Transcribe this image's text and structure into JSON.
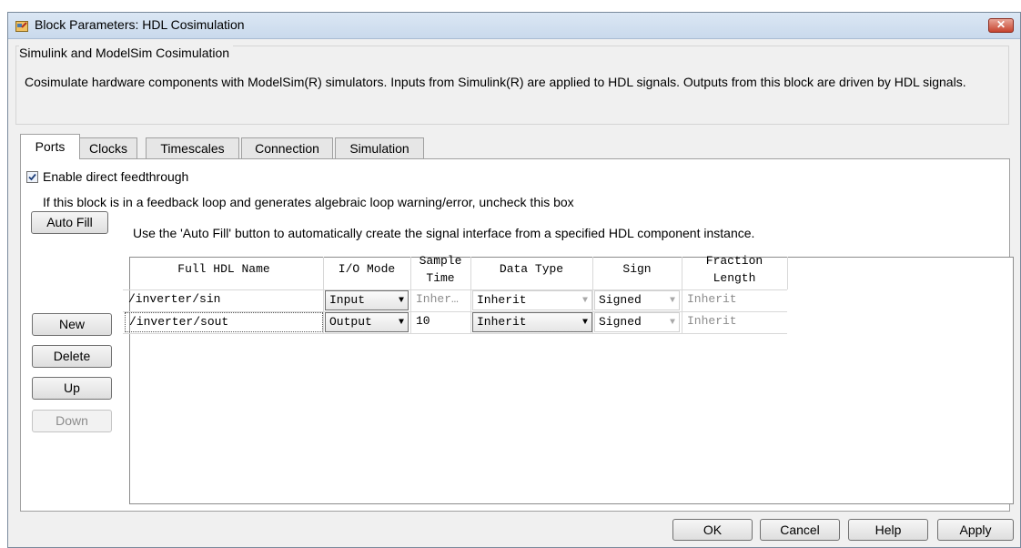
{
  "window": {
    "title": "Block Parameters: HDL Cosimulation"
  },
  "group": {
    "label": "Simulink and ModelSim Cosimulation",
    "description": "Cosimulate hardware components with ModelSim(R) simulators. Inputs from Simulink(R) are applied to HDL signals. Outputs from this block are driven by HDL signals."
  },
  "tabs": [
    "Ports",
    "Clocks",
    "Timescales",
    "Connection",
    "Simulation"
  ],
  "ports": {
    "feedthrough_label": "Enable direct feedthrough",
    "feedthrough_checked": true,
    "feedback_help": "If this block is in a feedback loop and generates algebraic loop warning/error, uncheck this box",
    "autofill_label": "Auto Fill",
    "autofill_hint": "Use the 'Auto Fill' button to automatically create the signal interface from a specified HDL component instance.",
    "columns": {
      "name": "Full HDL Name",
      "io": "I/O Mode",
      "sample1": "Sample",
      "sample2": "Time",
      "dtype": "Data Type",
      "sign": "Sign",
      "frac1": "Fraction",
      "frac2": "Length"
    },
    "rows": [
      {
        "name": "/inverter/sin",
        "io": "Input",
        "sample": "Inher…",
        "dtype": "Inherit",
        "sign": "Signed",
        "frac": "Inherit"
      },
      {
        "name": "/inverter/sout",
        "io": "Output",
        "sample": "10",
        "dtype": "Inherit",
        "sign": "Signed",
        "frac": "Inherit"
      }
    ],
    "buttons": {
      "new": "New",
      "delete": "Delete",
      "up": "Up",
      "down": "Down"
    }
  },
  "footer": {
    "ok": "OK",
    "cancel": "Cancel",
    "help": "Help",
    "apply": "Apply"
  },
  "colors": {
    "title_gradient": "#c9d9ec",
    "close": "#c7432e",
    "panel": "#f0f0f0"
  }
}
